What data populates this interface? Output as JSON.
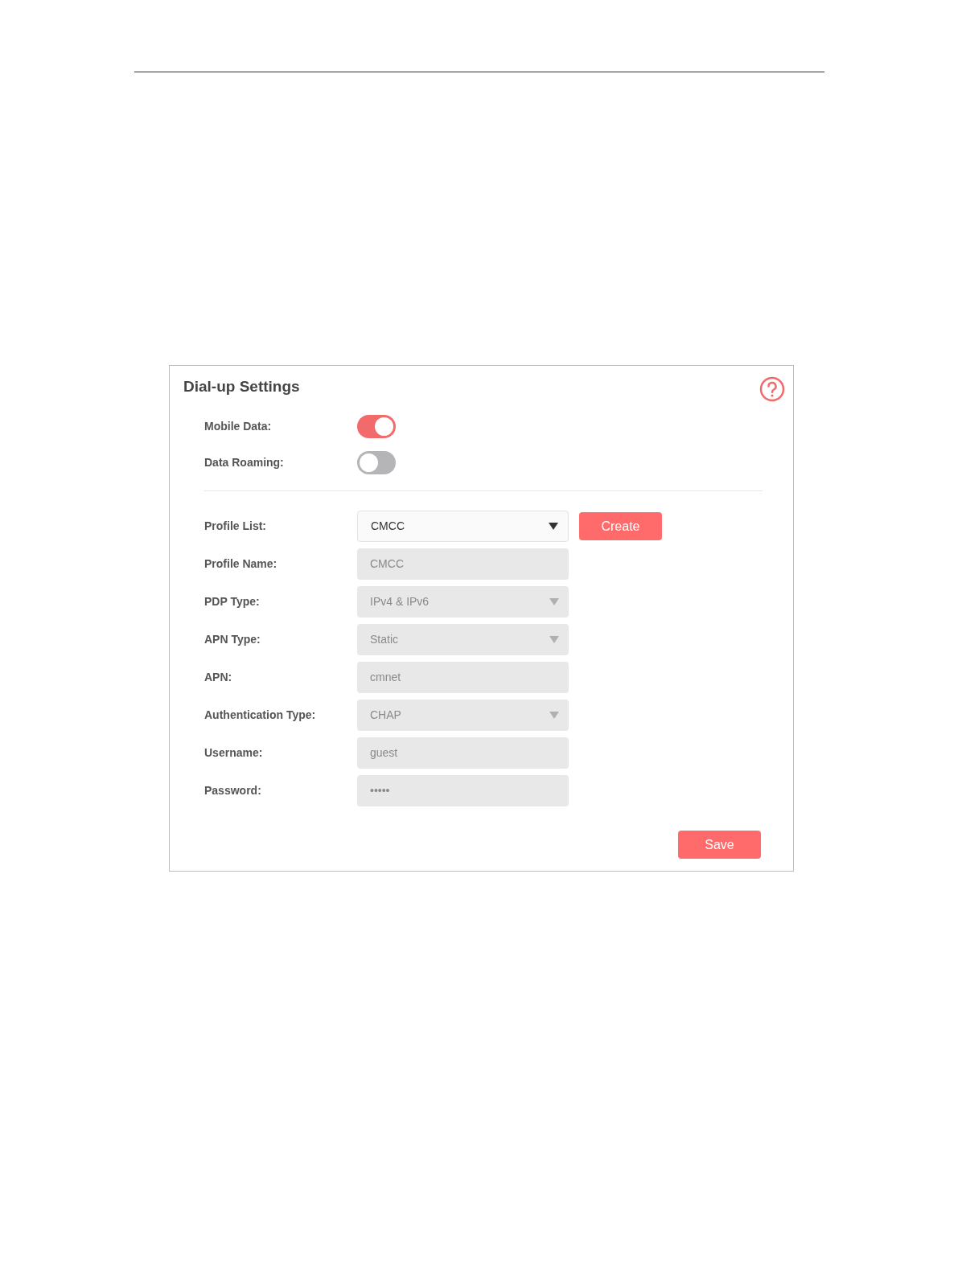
{
  "panel": {
    "title": "Dial-up Settings",
    "toggles": [
      {
        "label": "Mobile Data:",
        "on": true
      },
      {
        "label": "Data Roaming:",
        "on": false
      }
    ],
    "fields": [
      {
        "label": "Profile List:",
        "kind": "select",
        "value": "CMCC",
        "disabled": false
      },
      {
        "label": "Profile Name:",
        "kind": "text",
        "value": "CMCC",
        "disabled": true
      },
      {
        "label": "PDP Type:",
        "kind": "select",
        "value": "IPv4 & IPv6",
        "disabled": true
      },
      {
        "label": "APN Type:",
        "kind": "select",
        "value": "Static",
        "disabled": true
      },
      {
        "label": "APN:",
        "kind": "text",
        "value": "cmnet",
        "disabled": true
      },
      {
        "label": "Authentication Type:",
        "kind": "select",
        "value": "CHAP",
        "disabled": true
      },
      {
        "label": "Username:",
        "kind": "text",
        "value": "guest",
        "disabled": true
      },
      {
        "label": "Password:",
        "kind": "text",
        "value": "•••••",
        "disabled": true
      }
    ],
    "create_button": "Create",
    "save_button": "Save"
  }
}
